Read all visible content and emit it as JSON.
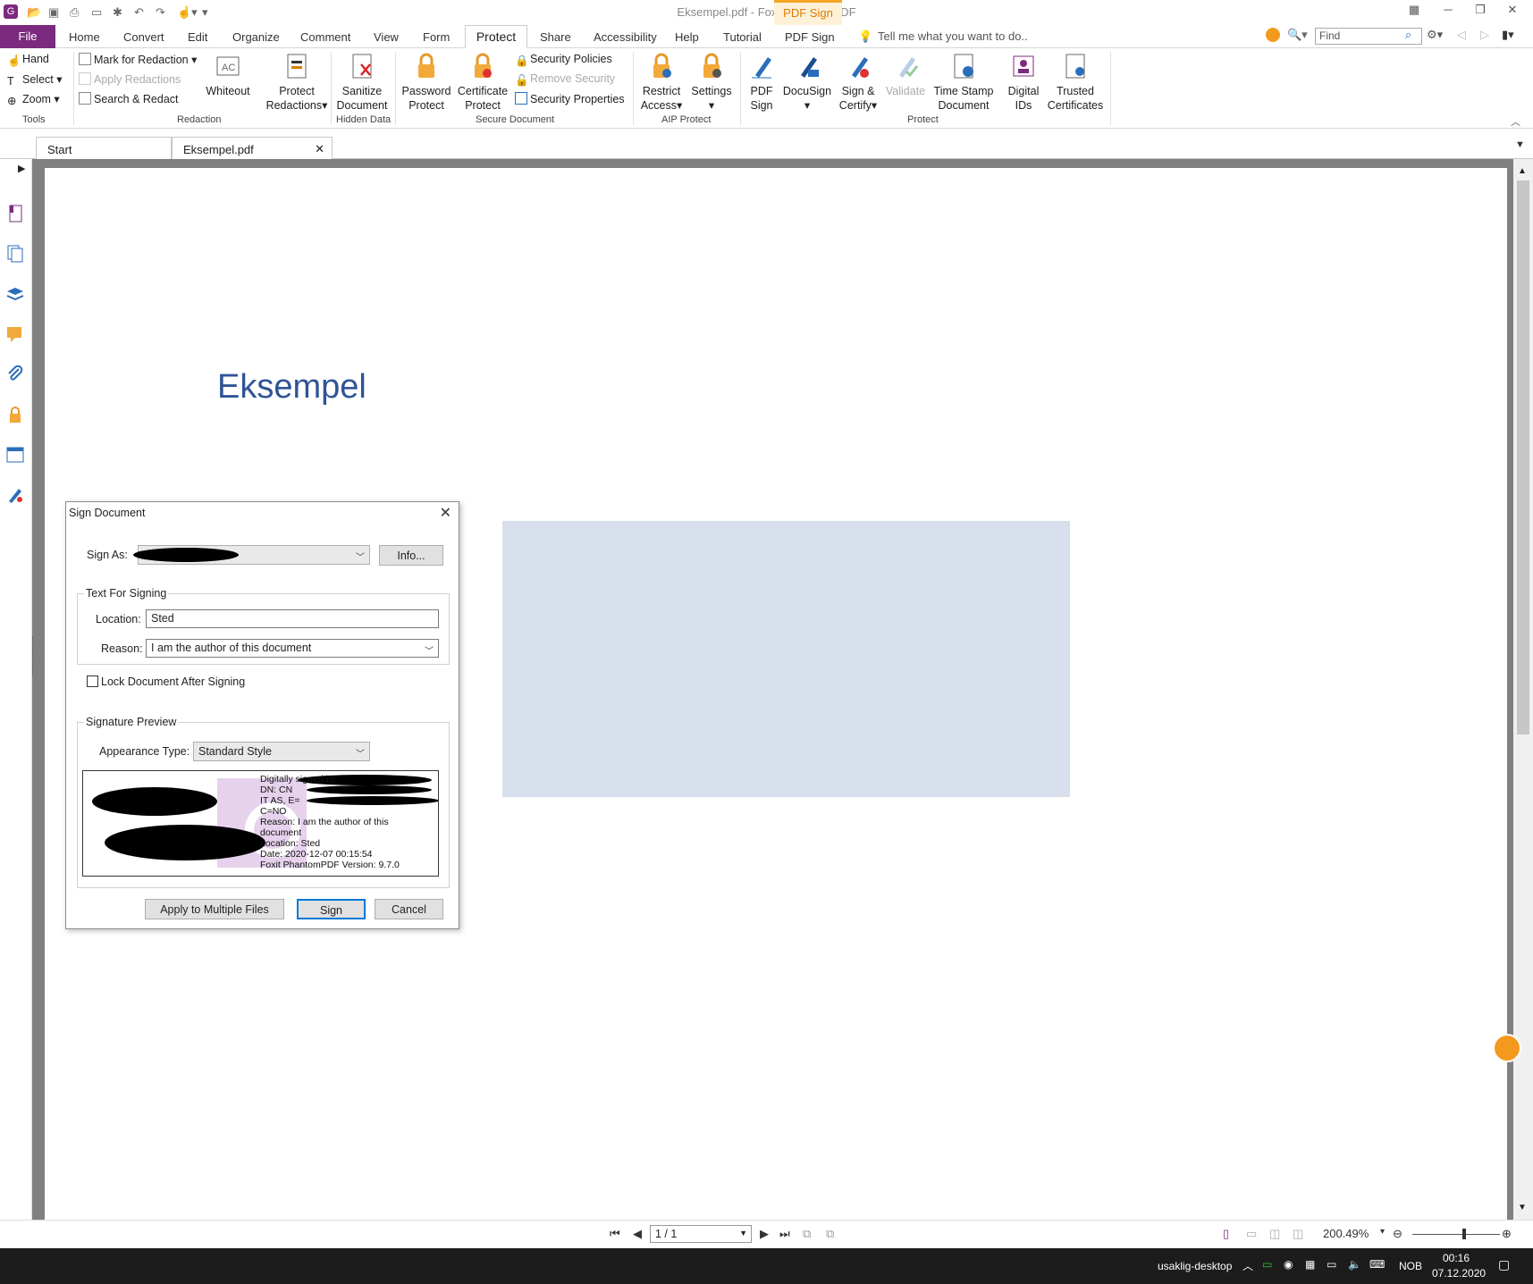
{
  "window": {
    "title": "Eksempel.pdf - Foxit PhantomPDF",
    "context_tab": "PDF Sign"
  },
  "menu": {
    "file": "File",
    "tabs": [
      "Home",
      "Convert",
      "Edit",
      "Organize",
      "Comment",
      "View",
      "Form"
    ],
    "active": "Protect",
    "tabs_right": [
      "Share",
      "Accessibility",
      "Help",
      "Tutorial",
      "PDF Sign"
    ],
    "tell_me": "Tell me what you want to do..",
    "find_placeholder": "Find"
  },
  "ribbon": {
    "tools": {
      "hand": "Hand",
      "select": "Select",
      "zoom": "Zoom",
      "group": "Tools"
    },
    "redaction": {
      "mark": "Mark for Redaction",
      "apply": "Apply Redactions",
      "search": "Search & Redact",
      "whiteout": "Whiteout",
      "protect_1": "Protect",
      "protect_2": "Redactions",
      "group": "Redaction"
    },
    "hidden": {
      "sanitize_1": "Sanitize",
      "sanitize_2": "Document",
      "group": "Hidden Data"
    },
    "secure": {
      "password_1": "Password",
      "password_2": "Protect",
      "cert_1": "Certificate",
      "cert_2": "Protect",
      "policies": "Security Policies",
      "remove": "Remove Security",
      "props": "Security Properties",
      "group": "Secure Document"
    },
    "aip": {
      "restrict_1": "Restrict",
      "restrict_2": "Access",
      "settings": "Settings",
      "group": "AIP Protect"
    },
    "protect": {
      "pdfsign_1": "PDF",
      "pdfsign_2": "Sign",
      "docusign": "DocuSign",
      "signcert_1": "Sign &",
      "signcert_2": "Certify",
      "validate": "Validate",
      "timestamp_1": "Time Stamp",
      "timestamp_2": "Document",
      "digital_1": "Digital",
      "digital_2": "IDs",
      "trusted_1": "Trusted",
      "trusted_2": "Certificates",
      "group": "Protect"
    }
  },
  "doc_tabs": {
    "start": "Start",
    "current": "Eksempel.pdf"
  },
  "document": {
    "heading": "Eksempel"
  },
  "dialog": {
    "title": "Sign Document",
    "sign_as_label": "Sign As:",
    "info_button": "Info...",
    "text_for_signing": "Text For Signing",
    "location_label": "Location:",
    "location_value": "Sted",
    "reason_label": "Reason:",
    "reason_value": "I am the author of this document",
    "lock_label": "Lock Document After Signing",
    "signature_preview": "Signature Preview",
    "appearance_label": "Appearance Type:",
    "appearance_value": "Standard Style",
    "preview_lines": [
      "Digitally signed by",
      "DN: CN",
      "IT AS, E=",
      "C=NO",
      "Reason: I am the author of this",
      "document",
      "Location: Sted",
      "Date: 2020-12-07 00:15:54",
      "Foxit PhantomPDF Version: 9.7.0"
    ],
    "apply_multiple": "Apply to Multiple Files",
    "sign": "Sign",
    "cancel": "Cancel"
  },
  "status": {
    "page": "1 / 1",
    "zoom": "200.49%"
  },
  "taskbar": {
    "host": "usaklig-desktop",
    "lang": "NOB",
    "time": "00:16",
    "date": "07.12.2020"
  },
  "colors": {
    "accent": "#7c2a7f",
    "doc_heading": "#2f5496",
    "sig_field": "#d8dfec",
    "context": "#f5a623"
  }
}
